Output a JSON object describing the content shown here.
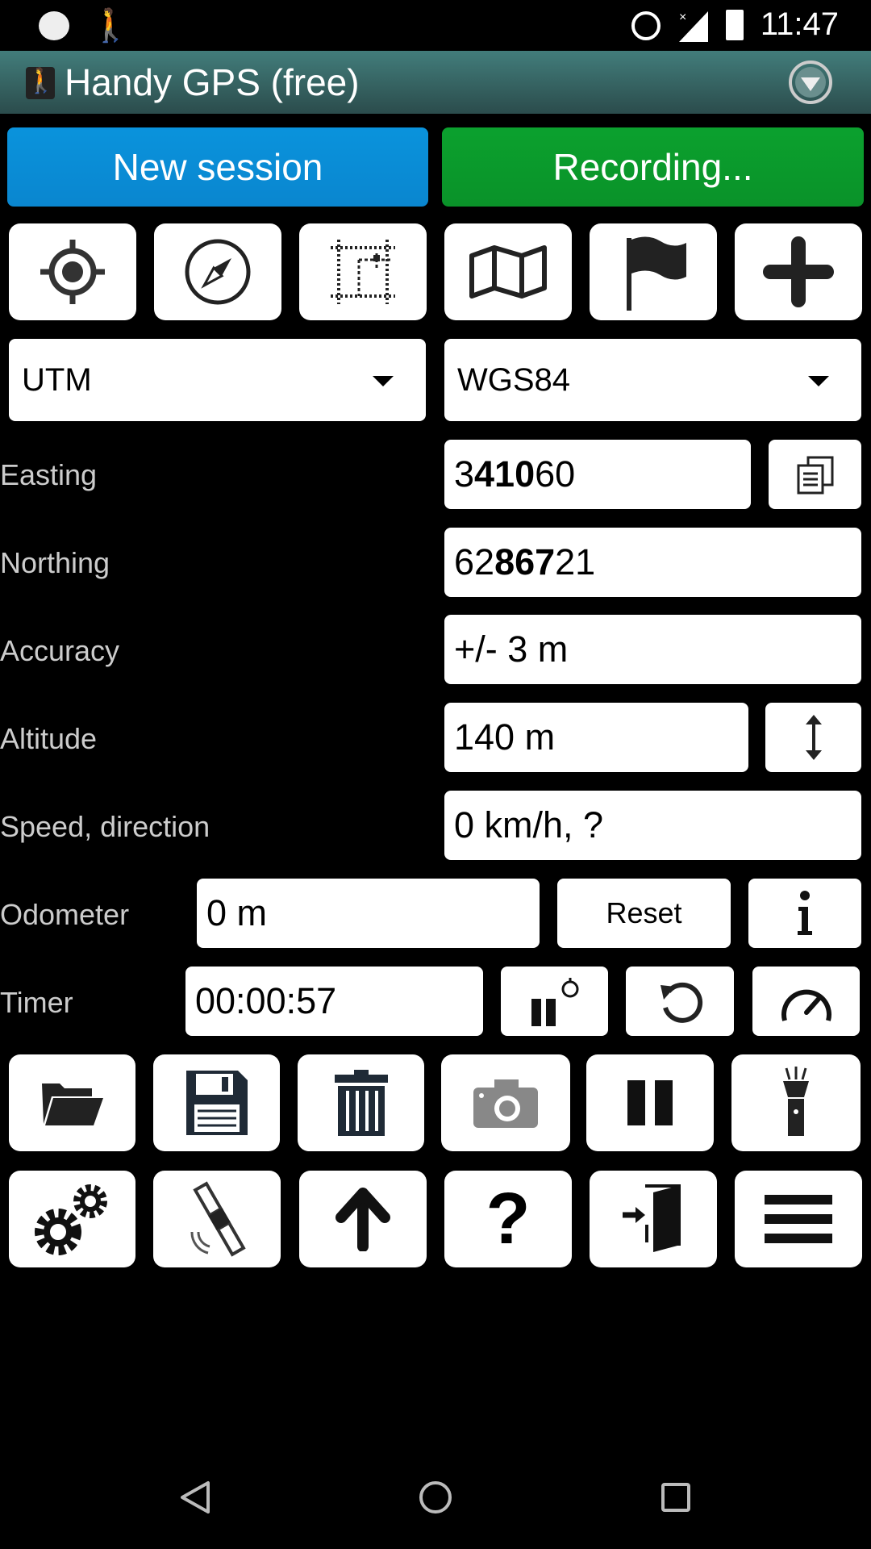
{
  "status_bar": {
    "time": "11:47",
    "icons": [
      "notification-app-icon",
      "handy-gps-icon",
      "alarm-icon",
      "no-signal-icon",
      "battery-charging-icon"
    ]
  },
  "app_bar": {
    "title": "Handy GPS (free)",
    "menu_icon": "dropdown-circle-icon"
  },
  "session": {
    "new_label": "New session",
    "recording_label": "Recording...",
    "new_color": "#0a8fd8",
    "recording_color": "#0b9a2c"
  },
  "tool_row": [
    "gps-target-icon",
    "compass-icon",
    "area-grid-icon",
    "map-icon",
    "flag-icon",
    "plus-icon"
  ],
  "coord_format": {
    "selected": "UTM"
  },
  "datum": {
    "selected": "WGS84"
  },
  "fields": {
    "easting": {
      "label": "Easting",
      "pre": "3",
      "bold": "410",
      "post": "60"
    },
    "northing": {
      "label": "Northing",
      "pre": "62",
      "bold": "867",
      "post": "21"
    },
    "accuracy": {
      "label": "Accuracy",
      "value": "+/- 3 m"
    },
    "altitude": {
      "label": "Altitude",
      "value": "140 m"
    },
    "speed": {
      "label": "Speed, direction",
      "value": "0 km/h, ?"
    },
    "odometer": {
      "label": "Odometer",
      "value": "0 m",
      "reset_label": "Reset"
    },
    "timer": {
      "label": "Timer",
      "value": "00:00:57"
    }
  },
  "action_row_1": [
    "folder-open-icon",
    "save-icon",
    "trash-icon",
    "camera-icon",
    "pause-icon",
    "flashlight-icon"
  ],
  "action_row_2": [
    "settings-gears-icon",
    "satellite-icon",
    "arrow-up-icon",
    "help-icon",
    "exit-door-icon",
    "menu-icon"
  ],
  "nav_bar": [
    "back-icon",
    "home-icon",
    "recents-icon"
  ]
}
